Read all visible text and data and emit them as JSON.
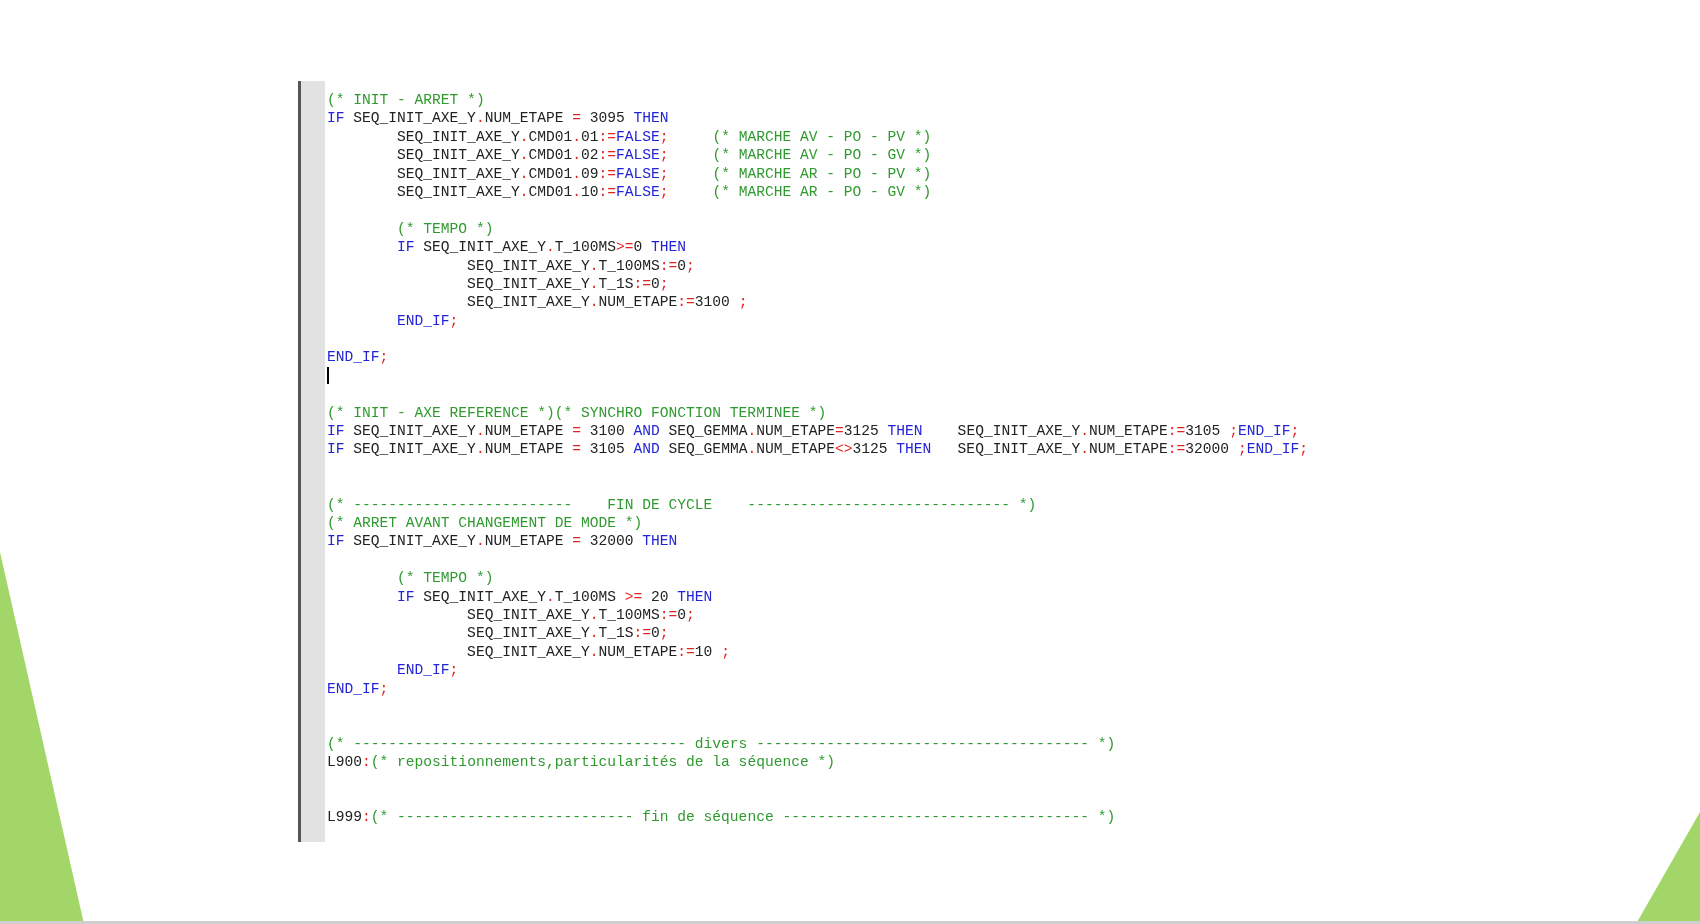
{
  "editor": {
    "lines": [
      {
        "kind": "code",
        "tokens": [
          {
            "kind": "comment",
            "text": "(* INIT - ARRET *)"
          }
        ]
      },
      {
        "kind": "code",
        "tokens": [
          {
            "kind": "keyword",
            "text": "IF"
          },
          {
            "kind": "plain",
            "text": " SEQ_INIT_AXE_Y"
          },
          {
            "kind": "operator",
            "text": "."
          },
          {
            "kind": "plain",
            "text": "NUM_ETAPE "
          },
          {
            "kind": "operator",
            "text": "="
          },
          {
            "kind": "plain",
            "text": " 3095 "
          },
          {
            "kind": "keyword",
            "text": "THEN"
          }
        ]
      },
      {
        "kind": "code",
        "tokens": [
          {
            "kind": "plain",
            "text": "        SEQ_INIT_AXE_Y"
          },
          {
            "kind": "operator",
            "text": "."
          },
          {
            "kind": "plain",
            "text": "CMD01"
          },
          {
            "kind": "operator",
            "text": "."
          },
          {
            "kind": "plain",
            "text": "01"
          },
          {
            "kind": "operator",
            "text": ":="
          },
          {
            "kind": "keyword",
            "text": "FALSE"
          },
          {
            "kind": "operator",
            "text": ";"
          },
          {
            "kind": "comment",
            "text": "     (* MARCHE AV - PO - PV *)"
          }
        ]
      },
      {
        "kind": "code",
        "tokens": [
          {
            "kind": "plain",
            "text": "        SEQ_INIT_AXE_Y"
          },
          {
            "kind": "operator",
            "text": "."
          },
          {
            "kind": "plain",
            "text": "CMD01"
          },
          {
            "kind": "operator",
            "text": "."
          },
          {
            "kind": "plain",
            "text": "02"
          },
          {
            "kind": "operator",
            "text": ":="
          },
          {
            "kind": "keyword",
            "text": "FALSE"
          },
          {
            "kind": "operator",
            "text": ";"
          },
          {
            "kind": "comment",
            "text": "     (* MARCHE AV - PO - GV *)"
          }
        ]
      },
      {
        "kind": "code",
        "tokens": [
          {
            "kind": "plain",
            "text": "        SEQ_INIT_AXE_Y"
          },
          {
            "kind": "operator",
            "text": "."
          },
          {
            "kind": "plain",
            "text": "CMD01"
          },
          {
            "kind": "operator",
            "text": "."
          },
          {
            "kind": "plain",
            "text": "09"
          },
          {
            "kind": "operator",
            "text": ":="
          },
          {
            "kind": "keyword",
            "text": "FALSE"
          },
          {
            "kind": "operator",
            "text": ";"
          },
          {
            "kind": "comment",
            "text": "     (* MARCHE AR - PO - PV *)"
          }
        ]
      },
      {
        "kind": "code",
        "tokens": [
          {
            "kind": "plain",
            "text": "        SEQ_INIT_AXE_Y"
          },
          {
            "kind": "operator",
            "text": "."
          },
          {
            "kind": "plain",
            "text": "CMD01"
          },
          {
            "kind": "operator",
            "text": "."
          },
          {
            "kind": "plain",
            "text": "10"
          },
          {
            "kind": "operator",
            "text": ":="
          },
          {
            "kind": "keyword",
            "text": "FALSE"
          },
          {
            "kind": "operator",
            "text": ";"
          },
          {
            "kind": "comment",
            "text": "     (* MARCHE AR - PO - GV *)"
          }
        ]
      },
      {
        "kind": "blank"
      },
      {
        "kind": "code",
        "tokens": [
          {
            "kind": "comment",
            "text": "        (* TEMPO *)"
          }
        ]
      },
      {
        "kind": "code",
        "tokens": [
          {
            "kind": "keyword",
            "text": "        IF"
          },
          {
            "kind": "plain",
            "text": " SEQ_INIT_AXE_Y"
          },
          {
            "kind": "operator",
            "text": "."
          },
          {
            "kind": "plain",
            "text": "T_100MS"
          },
          {
            "kind": "operator",
            "text": ">="
          },
          {
            "kind": "plain",
            "text": "0 "
          },
          {
            "kind": "keyword",
            "text": "THEN"
          }
        ]
      },
      {
        "kind": "code",
        "tokens": [
          {
            "kind": "plain",
            "text": "                SEQ_INIT_AXE_Y"
          },
          {
            "kind": "operator",
            "text": "."
          },
          {
            "kind": "plain",
            "text": "T_100MS"
          },
          {
            "kind": "operator",
            "text": ":="
          },
          {
            "kind": "plain",
            "text": "0"
          },
          {
            "kind": "operator",
            "text": ";"
          }
        ]
      },
      {
        "kind": "code",
        "tokens": [
          {
            "kind": "plain",
            "text": "                SEQ_INIT_AXE_Y"
          },
          {
            "kind": "operator",
            "text": "."
          },
          {
            "kind": "plain",
            "text": "T_1S"
          },
          {
            "kind": "operator",
            "text": ":="
          },
          {
            "kind": "plain",
            "text": "0"
          },
          {
            "kind": "operator",
            "text": ";"
          }
        ]
      },
      {
        "kind": "code",
        "tokens": [
          {
            "kind": "plain",
            "text": "                SEQ_INIT_AXE_Y"
          },
          {
            "kind": "operator",
            "text": "."
          },
          {
            "kind": "plain",
            "text": "NUM_ETAPE"
          },
          {
            "kind": "operator",
            "text": ":="
          },
          {
            "kind": "plain",
            "text": "3100 "
          },
          {
            "kind": "operator",
            "text": ";"
          }
        ]
      },
      {
        "kind": "code",
        "tokens": [
          {
            "kind": "keyword",
            "text": "        END_IF"
          },
          {
            "kind": "operator",
            "text": ";"
          }
        ]
      },
      {
        "kind": "blank"
      },
      {
        "kind": "code",
        "tokens": [
          {
            "kind": "keyword",
            "text": "END_IF"
          },
          {
            "kind": "operator",
            "text": ";"
          }
        ]
      },
      {
        "kind": "cursor"
      },
      {
        "kind": "blank"
      },
      {
        "kind": "code",
        "tokens": [
          {
            "kind": "comment",
            "text": "(* INIT - AXE REFERENCE *)(* SYNCHRO FONCTION TERMINEE *)"
          }
        ]
      },
      {
        "kind": "code",
        "tokens": [
          {
            "kind": "keyword",
            "text": "IF"
          },
          {
            "kind": "plain",
            "text": " SEQ_INIT_AXE_Y"
          },
          {
            "kind": "operator",
            "text": "."
          },
          {
            "kind": "plain",
            "text": "NUM_ETAPE "
          },
          {
            "kind": "operator",
            "text": "="
          },
          {
            "kind": "plain",
            "text": " 3100 "
          },
          {
            "kind": "keyword",
            "text": "AND"
          },
          {
            "kind": "plain",
            "text": " SEQ_GEMMA"
          },
          {
            "kind": "operator",
            "text": "."
          },
          {
            "kind": "plain",
            "text": "NUM_ETAPE"
          },
          {
            "kind": "operator",
            "text": "="
          },
          {
            "kind": "plain",
            "text": "3125 "
          },
          {
            "kind": "keyword",
            "text": "THEN"
          },
          {
            "kind": "plain",
            "text": "    SEQ_INIT_AXE_Y"
          },
          {
            "kind": "operator",
            "text": "."
          },
          {
            "kind": "plain",
            "text": "NUM_ETAPE"
          },
          {
            "kind": "operator",
            "text": ":="
          },
          {
            "kind": "plain",
            "text": "3105 "
          },
          {
            "kind": "operator",
            "text": ";"
          },
          {
            "kind": "keyword",
            "text": "END_IF"
          },
          {
            "kind": "operator",
            "text": ";"
          }
        ]
      },
      {
        "kind": "code",
        "tokens": [
          {
            "kind": "keyword",
            "text": "IF"
          },
          {
            "kind": "plain",
            "text": " SEQ_INIT_AXE_Y"
          },
          {
            "kind": "operator",
            "text": "."
          },
          {
            "kind": "plain",
            "text": "NUM_ETAPE "
          },
          {
            "kind": "operator",
            "text": "="
          },
          {
            "kind": "plain",
            "text": " 3105 "
          },
          {
            "kind": "keyword",
            "text": "AND"
          },
          {
            "kind": "plain",
            "text": " SEQ_GEMMA"
          },
          {
            "kind": "operator",
            "text": "."
          },
          {
            "kind": "plain",
            "text": "NUM_ETAPE"
          },
          {
            "kind": "operator",
            "text": "<>"
          },
          {
            "kind": "plain",
            "text": "3125 "
          },
          {
            "kind": "keyword",
            "text": "THEN"
          },
          {
            "kind": "plain",
            "text": "   SEQ_INIT_AXE_Y"
          },
          {
            "kind": "operator",
            "text": "."
          },
          {
            "kind": "plain",
            "text": "NUM_ETAPE"
          },
          {
            "kind": "operator",
            "text": ":="
          },
          {
            "kind": "plain",
            "text": "32000 "
          },
          {
            "kind": "operator",
            "text": ";"
          },
          {
            "kind": "keyword",
            "text": "END_IF"
          },
          {
            "kind": "operator",
            "text": ";"
          }
        ]
      },
      {
        "kind": "blank"
      },
      {
        "kind": "blank"
      },
      {
        "kind": "code",
        "tokens": [
          {
            "kind": "comment",
            "text": "(* -------------------------    FIN DE CYCLE    ------------------------------ *)"
          }
        ]
      },
      {
        "kind": "code",
        "tokens": [
          {
            "kind": "comment",
            "text": "(* ARRET AVANT CHANGEMENT DE MODE *)"
          }
        ]
      },
      {
        "kind": "code",
        "tokens": [
          {
            "kind": "keyword",
            "text": "IF"
          },
          {
            "kind": "plain",
            "text": " SEQ_INIT_AXE_Y"
          },
          {
            "kind": "operator",
            "text": "."
          },
          {
            "kind": "plain",
            "text": "NUM_ETAPE "
          },
          {
            "kind": "operator",
            "text": "="
          },
          {
            "kind": "plain",
            "text": " 32000 "
          },
          {
            "kind": "keyword",
            "text": "THEN"
          }
        ]
      },
      {
        "kind": "blank"
      },
      {
        "kind": "code",
        "tokens": [
          {
            "kind": "comment",
            "text": "        (* TEMPO *)"
          }
        ]
      },
      {
        "kind": "code",
        "tokens": [
          {
            "kind": "keyword",
            "text": "        IF"
          },
          {
            "kind": "plain",
            "text": " SEQ_INIT_AXE_Y"
          },
          {
            "kind": "operator",
            "text": "."
          },
          {
            "kind": "plain",
            "text": "T_100MS "
          },
          {
            "kind": "operator",
            "text": ">="
          },
          {
            "kind": "plain",
            "text": " 20 "
          },
          {
            "kind": "keyword",
            "text": "THEN"
          }
        ]
      },
      {
        "kind": "code",
        "tokens": [
          {
            "kind": "plain",
            "text": "                SEQ_INIT_AXE_Y"
          },
          {
            "kind": "operator",
            "text": "."
          },
          {
            "kind": "plain",
            "text": "T_100MS"
          },
          {
            "kind": "operator",
            "text": ":="
          },
          {
            "kind": "plain",
            "text": "0"
          },
          {
            "kind": "operator",
            "text": ";"
          }
        ]
      },
      {
        "kind": "code",
        "tokens": [
          {
            "kind": "plain",
            "text": "                SEQ_INIT_AXE_Y"
          },
          {
            "kind": "operator",
            "text": "."
          },
          {
            "kind": "plain",
            "text": "T_1S"
          },
          {
            "kind": "operator",
            "text": ":="
          },
          {
            "kind": "plain",
            "text": "0"
          },
          {
            "kind": "operator",
            "text": ";"
          }
        ]
      },
      {
        "kind": "code",
        "tokens": [
          {
            "kind": "plain",
            "text": "                SEQ_INIT_AXE_Y"
          },
          {
            "kind": "operator",
            "text": "."
          },
          {
            "kind": "plain",
            "text": "NUM_ETAPE"
          },
          {
            "kind": "operator",
            "text": ":="
          },
          {
            "kind": "plain",
            "text": "10 "
          },
          {
            "kind": "operator",
            "text": ";"
          }
        ]
      },
      {
        "kind": "code",
        "tokens": [
          {
            "kind": "keyword",
            "text": "        END_IF"
          },
          {
            "kind": "operator",
            "text": ";"
          }
        ]
      },
      {
        "kind": "code",
        "tokens": [
          {
            "kind": "keyword",
            "text": "END_IF"
          },
          {
            "kind": "operator",
            "text": ";"
          }
        ]
      },
      {
        "kind": "blank"
      },
      {
        "kind": "blank"
      },
      {
        "kind": "code",
        "tokens": [
          {
            "kind": "comment",
            "text": "(* -------------------------------------- divers -------------------------------------- *)"
          }
        ]
      },
      {
        "kind": "code",
        "tokens": [
          {
            "kind": "plain",
            "text": "L900"
          },
          {
            "kind": "operator",
            "text": ":"
          },
          {
            "kind": "comment",
            "text": "(* repositionnements,particularités de la séquence *)"
          }
        ]
      },
      {
        "kind": "blank"
      },
      {
        "kind": "blank"
      },
      {
        "kind": "code",
        "tokens": [
          {
            "kind": "plain",
            "text": "L999"
          },
          {
            "kind": "operator",
            "text": ":"
          },
          {
            "kind": "comment",
            "text": "(* --------------------------- fin de séquence ----------------------------------- *)"
          }
        ]
      }
    ]
  }
}
